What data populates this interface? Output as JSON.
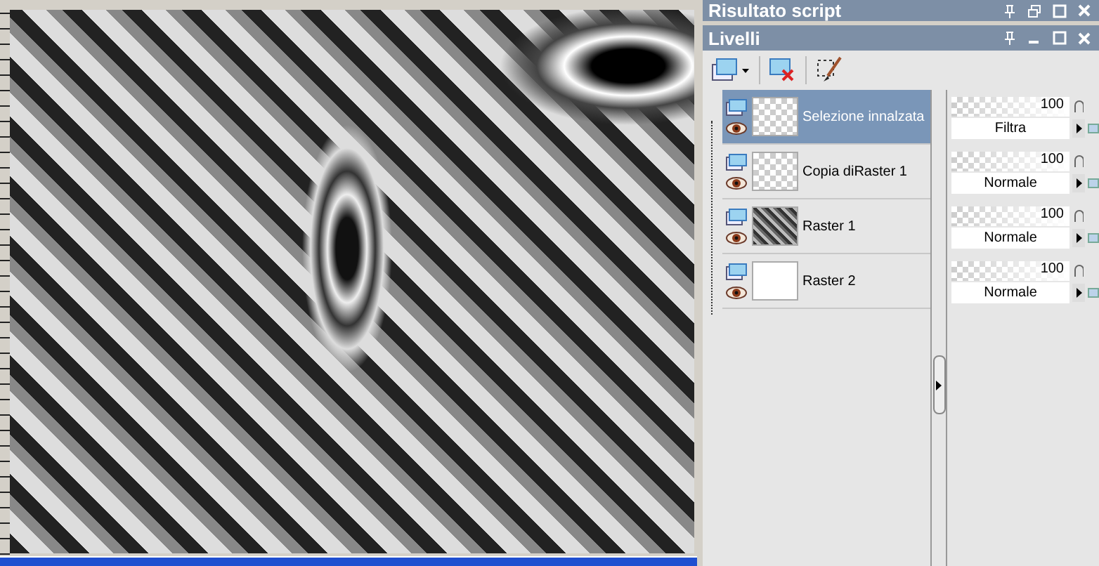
{
  "script_panel": {
    "title": "Risultato script"
  },
  "layers_panel": {
    "title": "Livelli",
    "layers": [
      {
        "name": "Selezione innalzata",
        "selected": true,
        "kind": "transparent",
        "opacity": "100",
        "blend": "Filtra"
      },
      {
        "name": "Copia diRaster 1",
        "selected": false,
        "kind": "transparent",
        "opacity": "100",
        "blend": "Normale"
      },
      {
        "name": "Raster 1",
        "selected": false,
        "kind": "pattern",
        "opacity": "100",
        "blend": "Normale"
      },
      {
        "name": "Raster 2",
        "selected": false,
        "kind": "white",
        "opacity": "100",
        "blend": "Normale"
      }
    ]
  }
}
